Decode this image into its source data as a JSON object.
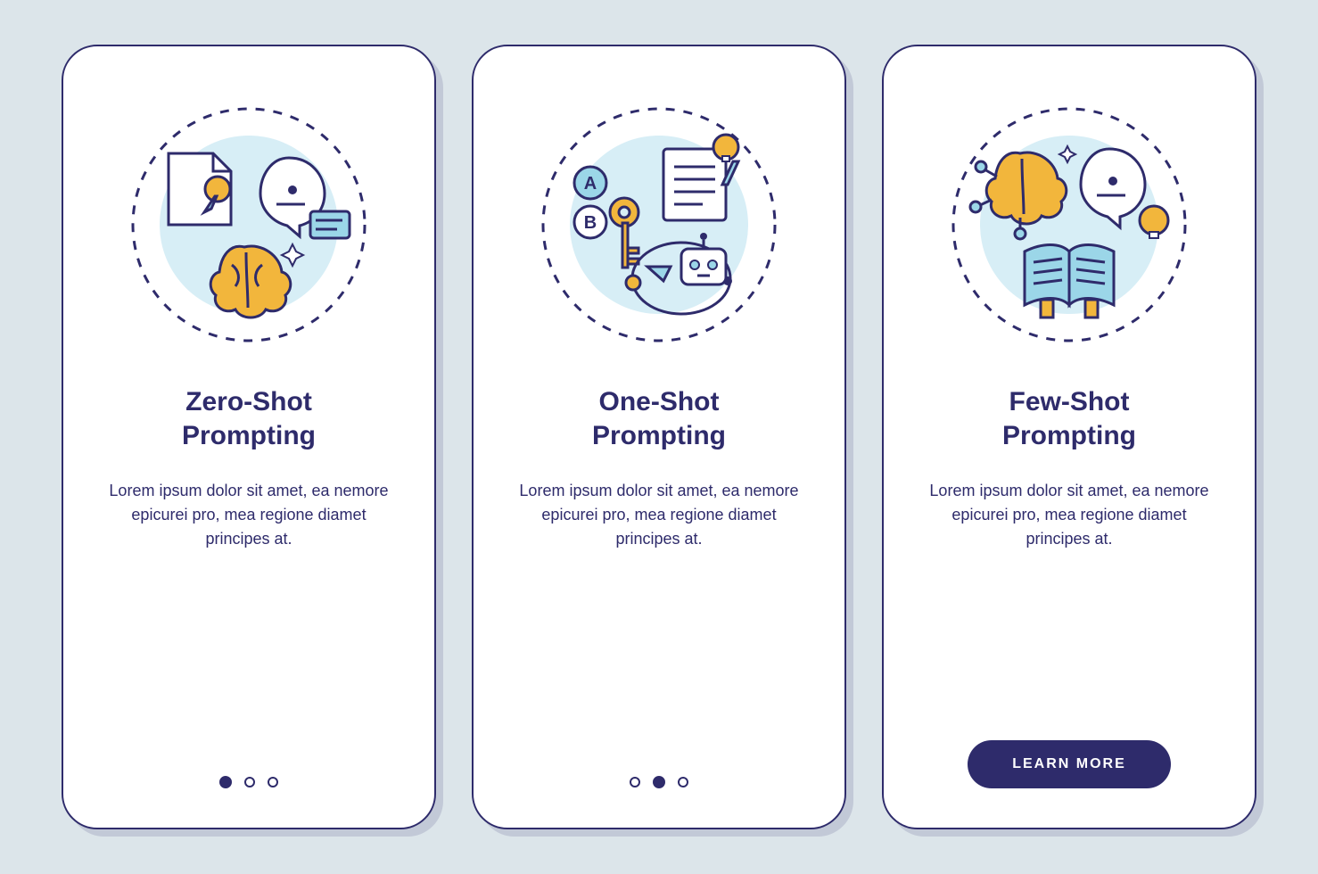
{
  "colors": {
    "deep_navy": "#2e2b6b",
    "gold": "#f2b63c",
    "sky": "#9bd6e8",
    "pale_sky": "#d7eef6",
    "white": "#ffffff",
    "page_bg": "#dce5ea"
  },
  "cards": [
    {
      "title": "Zero-Shot\nPrompting",
      "description": "Lorem ipsum dolor sit amet, ea nemore epicurei pro, mea regione diamet principes at.",
      "illus": "zero-shot",
      "pager": {
        "type": "dots",
        "count": 3,
        "active_index": 0
      }
    },
    {
      "title": "One-Shot\nPrompting",
      "description": "Lorem ipsum dolor sit amet, ea nemore epicurei pro, mea regione diamet principes at.",
      "illus": "one-shot",
      "pager": {
        "type": "dots",
        "count": 3,
        "active_index": 1
      }
    },
    {
      "title": "Few-Shot\nPrompting",
      "description": "Lorem ipsum dolor sit amet, ea nemore epicurei pro, mea regione diamet principes at.",
      "illus": "few-shot",
      "cta_label": "LEARN MORE"
    }
  ]
}
